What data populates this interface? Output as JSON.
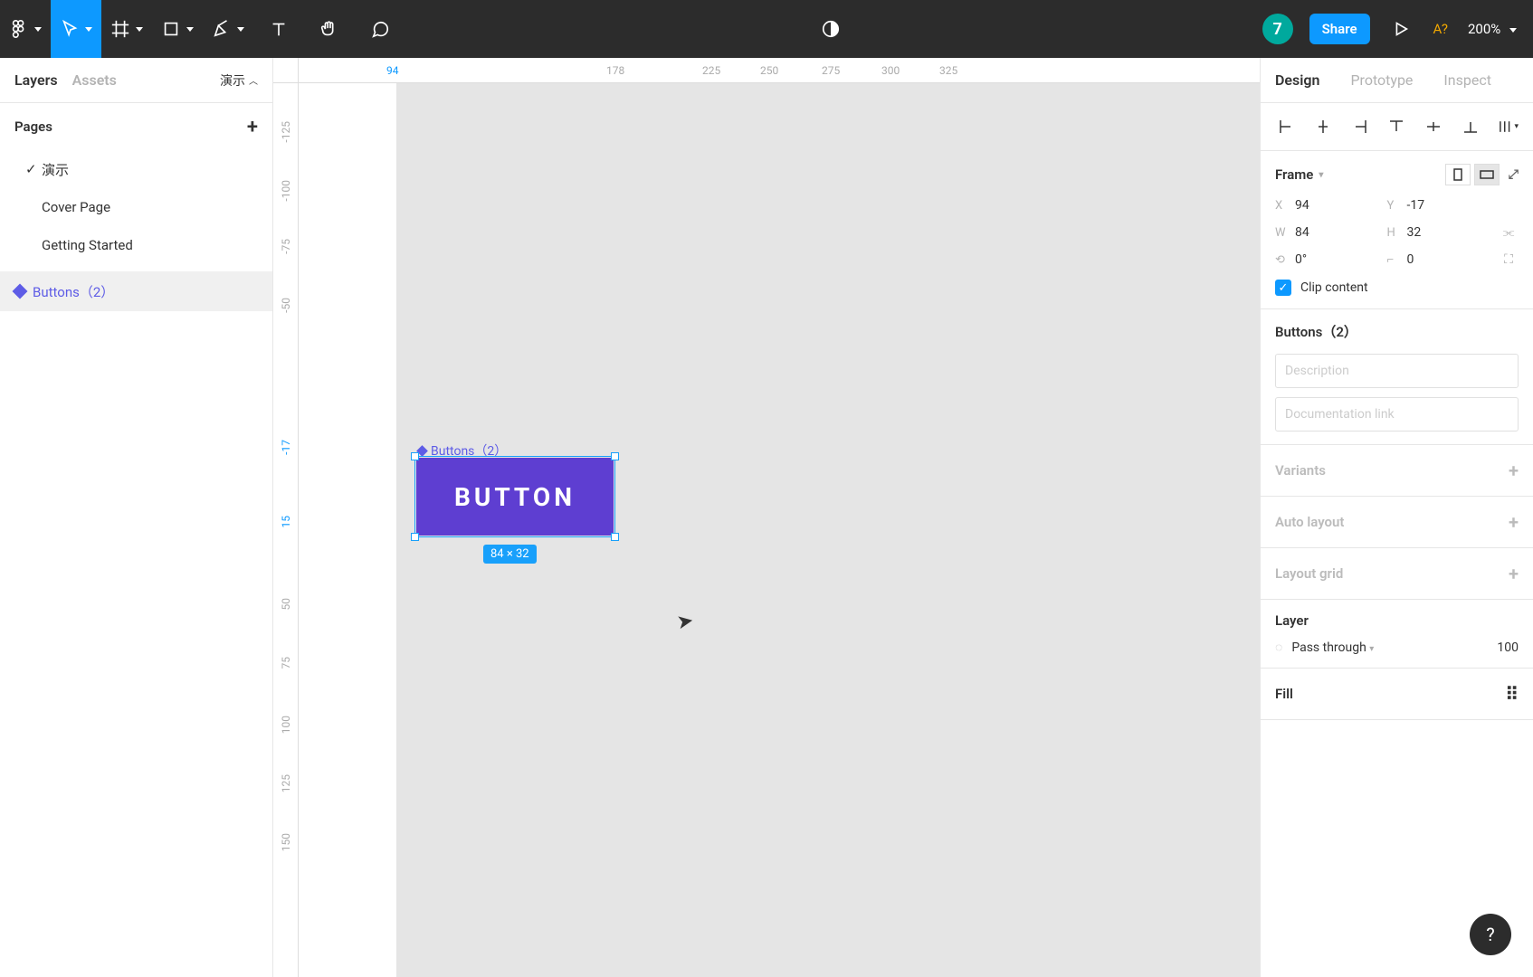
{
  "toolbar": {
    "share_label": "Share",
    "missing_fonts": "A?",
    "zoom": "200%"
  },
  "left": {
    "tab_layers": "Layers",
    "tab_assets": "Assets",
    "tabs_action": "演示",
    "pages_header": "Pages",
    "pages": [
      {
        "label": "演示",
        "checked": true
      },
      {
        "label": "Cover Page",
        "checked": false
      },
      {
        "label": "Getting Started",
        "checked": false
      }
    ],
    "selected_layer": "Buttons（2）"
  },
  "canvas": {
    "ruler_h": [
      "94",
      "178",
      "225",
      "250",
      "275",
      "300",
      "325"
    ],
    "ruler_v": [
      "-125",
      "-100",
      "-75",
      "-50",
      "-17",
      "15",
      "50",
      "75",
      "100",
      "125",
      "150"
    ],
    "sel_label": "Buttons（2）",
    "button_text": "BUTTON",
    "dim_label": "84 × 32"
  },
  "right": {
    "tab_design": "Design",
    "tab_prototype": "Prototype",
    "tab_inspect": "Inspect",
    "frame_header": "Frame",
    "props": {
      "x": "94",
      "y": "-17",
      "w": "84",
      "h": "32",
      "r": "0°",
      "c": "0"
    },
    "clip_label": "Clip content",
    "component_name": "Buttons（2）",
    "desc_placeholder": "Description",
    "doc_placeholder": "Documentation link",
    "sec_variants": "Variants",
    "sec_autolayout": "Auto layout",
    "sec_layoutgrid": "Layout grid",
    "layer_header": "Layer",
    "blend_mode": "Pass through",
    "opacity": "100",
    "fill_header": "Fill"
  }
}
